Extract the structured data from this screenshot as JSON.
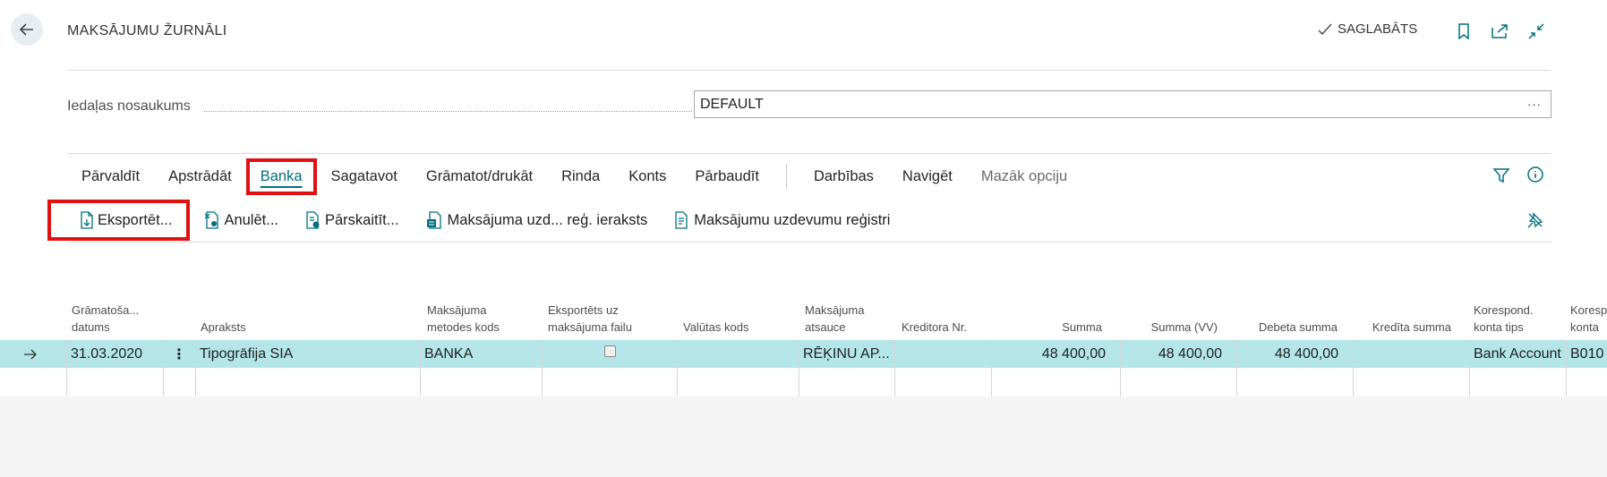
{
  "header": {
    "title": "MAKSĀJUMU ŽURNĀLI",
    "saved_label": "SAGLABĀTS"
  },
  "field": {
    "label": "Iedaļas nosaukums",
    "value": "DEFAULT",
    "more": "···"
  },
  "action_bar": {
    "items": [
      "Pārvaldīt",
      "Apstrādāt",
      "Banka",
      "Sagatavot",
      "Grāmatot/drukāt",
      "Rinda",
      "Konts",
      "Pārbaudīt"
    ],
    "items2": [
      "Darbības",
      "Navigēt"
    ],
    "less_options": "Mazāk opciju",
    "active_index": 2
  },
  "sub_actions": {
    "export": "Eksportēt...",
    "void": "Anulēt...",
    "recalc": "Pārskaitīt...",
    "payment_task_entry": "Maksājuma uzd... reģ. ieraksts",
    "payment_task_registers": "Maksājumu uzdevumu reģistri"
  },
  "columns": [
    {
      "key": "posting_date",
      "l1": "Grāmatoša...",
      "l2": "datums"
    },
    {
      "key": "description",
      "l1": "",
      "l2": "Apraksts"
    },
    {
      "key": "method_code",
      "l1": "Maksājuma",
      "l2": "metodes kods"
    },
    {
      "key": "exported",
      "l1": "Eksportēts uz",
      "l2": "maksājuma failu"
    },
    {
      "key": "currency",
      "l1": "",
      "l2": "Valūtas kods"
    },
    {
      "key": "reference",
      "l1": "Maksājuma",
      "l2": "atsauce"
    },
    {
      "key": "creditor",
      "l1": "",
      "l2": "Kreditora Nr."
    },
    {
      "key": "amount",
      "l1": "",
      "l2": "Summa"
    },
    {
      "key": "amount_lcy",
      "l1": "",
      "l2": "Summa (VV)"
    },
    {
      "key": "debit",
      "l1": "",
      "l2": "Debeta summa"
    },
    {
      "key": "credit",
      "l1": "",
      "l2": "Kredīta summa"
    },
    {
      "key": "bal_type",
      "l1": "Korespond.",
      "l2": "konta tips"
    },
    {
      "key": "bal_no",
      "l1": "Koresp",
      "l2": "konta"
    }
  ],
  "rows": [
    {
      "posting_date": "31.03.2020",
      "row_menu": "⋮",
      "description": "Tipogrāfija SIA",
      "method_code": "BANKA",
      "exported": false,
      "currency": "",
      "reference": "RĒĶINU AP...",
      "creditor": "",
      "amount": "48 400,00",
      "amount_lcy": "48 400,00",
      "debit": "48 400,00",
      "credit": "",
      "bal_type": "Bank Account",
      "bal_no": "B010"
    }
  ],
  "colors": {
    "accent": "#00717c",
    "selected_row": "#b3e5e9",
    "highlight": "#e01010"
  }
}
